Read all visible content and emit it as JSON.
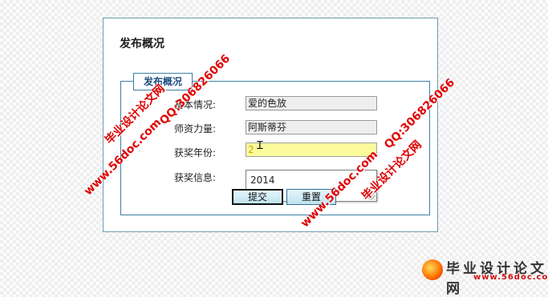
{
  "panel": {
    "title": "发布概况"
  },
  "form": {
    "legend": "发布概况",
    "fields": [
      {
        "label": "基本情况:",
        "value": "爱的色放"
      },
      {
        "label": "师资力量:",
        "value": "阿斯蒂芬"
      },
      {
        "label": "获奖年份:",
        "value": "2"
      },
      {
        "label": "获奖信息:",
        "value": ""
      }
    ],
    "autocomplete": {
      "items": [
        "2014"
      ]
    },
    "buttons": {
      "submit": "提交",
      "reset": "重置"
    }
  },
  "watermark": {
    "site": "毕业设计论文网",
    "qq": "QQ:306826066",
    "url": "www.56doc.com"
  },
  "logo": {
    "text": "毕业设计论文网",
    "url": "www.56doc.com"
  },
  "colors": {
    "border": "#3c7fa6",
    "watermark": "#e00000",
    "active_input": "#fbfb9c"
  }
}
